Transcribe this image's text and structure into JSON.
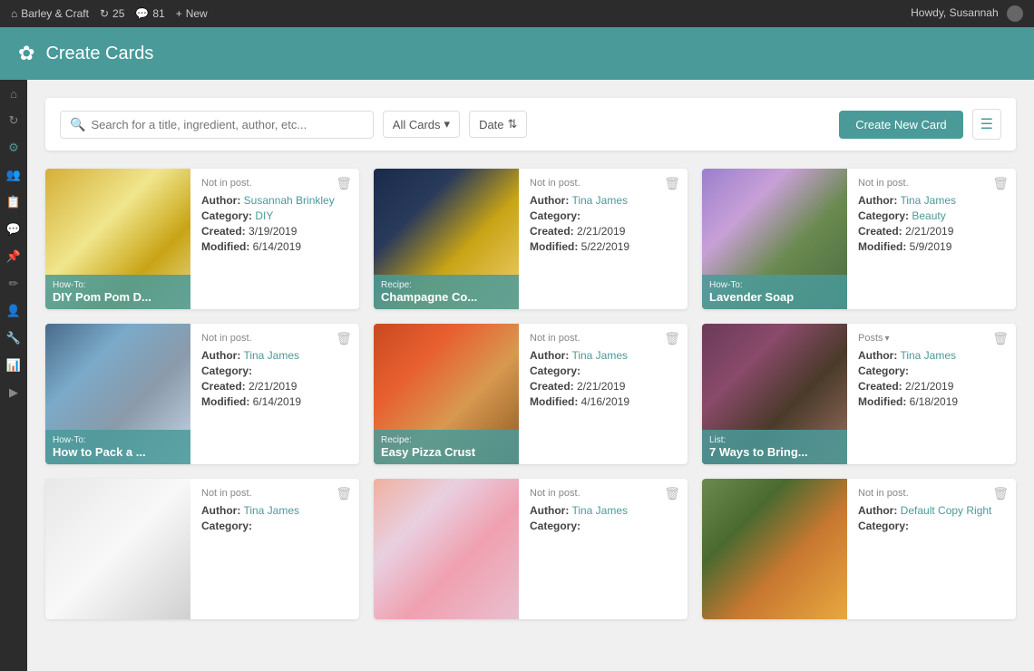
{
  "topBar": {
    "siteName": "Barley & Craft",
    "updates": "25",
    "messages": "81",
    "newLabel": "New",
    "userGreeting": "Howdy, Susannah"
  },
  "header": {
    "title": "Create Cards",
    "logoSymbol": "✿"
  },
  "toolbar": {
    "searchPlaceholder": "Search for a title, ingredient, author, etc...",
    "filterOptions": [
      "All Cards",
      "Date"
    ],
    "allCardsLabel": "All Cards",
    "dateLabel": "Date",
    "createButtonLabel": "Create New Card",
    "viewToggleLabel": "≡"
  },
  "sidebar": {
    "icons": [
      "⌂",
      "🔄",
      "⚙",
      "👥",
      "📋",
      "💬",
      "📌",
      "✏",
      "👤",
      "🔧",
      "📊",
      "▶"
    ]
  },
  "cards": [
    {
      "id": 1,
      "status": "Not in post.",
      "type": "How-To:",
      "title": "DIY Pom Pom D...",
      "author": "Susannah Brinkley",
      "authorLink": true,
      "category": "DIY",
      "categoryLink": true,
      "created": "3/19/2019",
      "modified": "6/14/2019",
      "imgClass": "img-gold"
    },
    {
      "id": 2,
      "status": "Not in post.",
      "type": "Recipe:",
      "title": "Champagne Co...",
      "author": "Tina James",
      "authorLink": true,
      "category": "",
      "categoryLink": false,
      "created": "2/21/2019",
      "modified": "5/22/2019",
      "imgClass": "img-champagne"
    },
    {
      "id": 3,
      "status": "Not in post.",
      "type": "How-To:",
      "title": "Lavender Soap",
      "author": "Tina James",
      "authorLink": true,
      "category": "Beauty",
      "categoryLink": true,
      "created": "2/21/2019",
      "modified": "5/9/2019",
      "imgClass": "img-lavender"
    },
    {
      "id": 4,
      "status": "Not in post.",
      "type": "How-To:",
      "title": "How to Pack a ...",
      "author": "Tina James",
      "authorLink": true,
      "category": "",
      "categoryLink": false,
      "created": "2/21/2019",
      "modified": "6/14/2019",
      "imgClass": "img-travel"
    },
    {
      "id": 5,
      "status": "Not in post.",
      "type": "Recipe:",
      "title": "Easy Pizza Crust",
      "author": "Tina James",
      "authorLink": true,
      "category": "",
      "categoryLink": false,
      "created": "2/21/2019",
      "modified": "4/16/2019",
      "imgClass": "img-pizza"
    },
    {
      "id": 6,
      "status": "Posts",
      "statusDropdown": true,
      "type": "List:",
      "title": "7 Ways to Bring...",
      "author": "Tina James",
      "authorLink": true,
      "category": "",
      "categoryLink": false,
      "created": "2/21/2019",
      "modified": "6/18/2019",
      "imgClass": "img-interior"
    },
    {
      "id": 7,
      "status": "Not in post.",
      "type": "",
      "title": "",
      "author": "Tina James",
      "authorLink": true,
      "category": "",
      "categoryLink": false,
      "created": "",
      "modified": "",
      "imgClass": "img-white"
    },
    {
      "id": 8,
      "status": "Not in post.",
      "type": "",
      "title": "",
      "author": "Tina James",
      "authorLink": true,
      "category": "",
      "categoryLink": false,
      "created": "",
      "modified": "",
      "imgClass": "img-gift"
    },
    {
      "id": 9,
      "status": "Not in post.",
      "type": "",
      "title": "",
      "author": "Default Copy Right",
      "authorLink": true,
      "category": "",
      "categoryLink": false,
      "created": "",
      "modified": "",
      "imgClass": "img-burger"
    }
  ],
  "labels": {
    "author": "Author:",
    "category": "Category:",
    "created": "Created:",
    "modified": "Modified:"
  }
}
